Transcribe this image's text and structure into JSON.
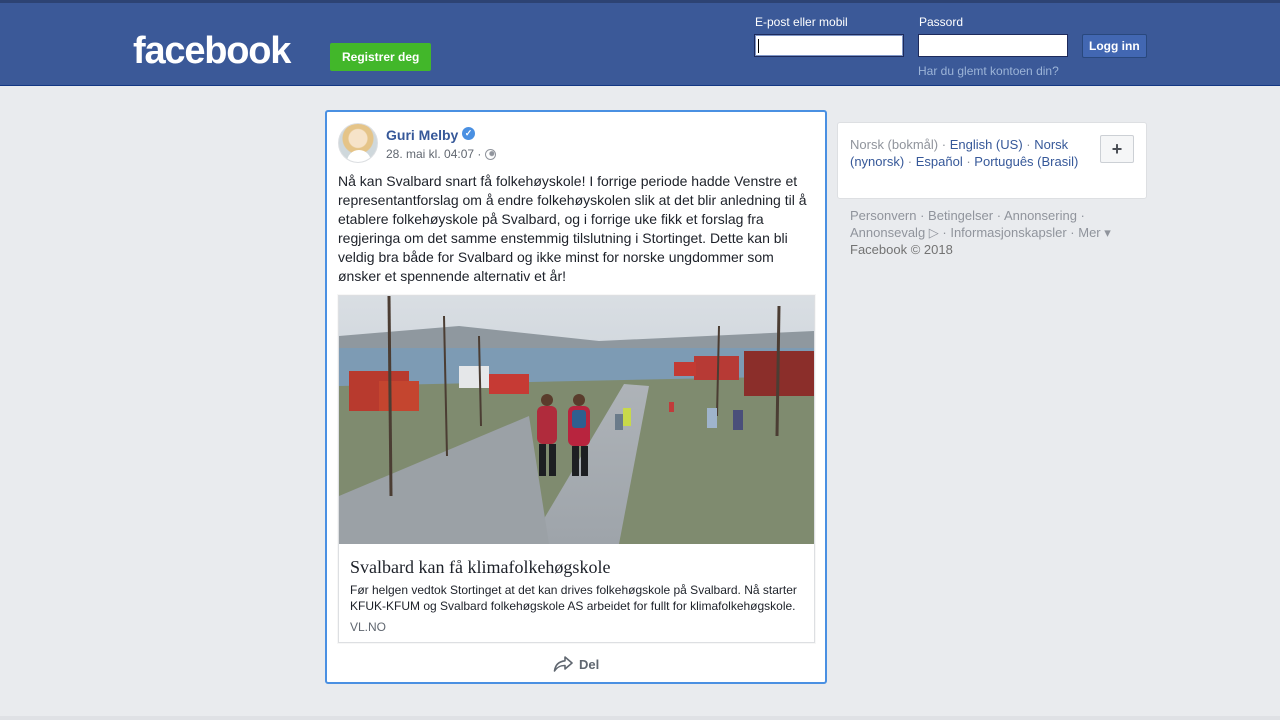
{
  "header": {
    "logo": "facebook",
    "register_label": "Registrer deg",
    "email_label": "E-post eller mobil",
    "password_label": "Passord",
    "login_label": "Logg inn",
    "forgot_label": "Har du glemt kontoen din?",
    "email_value": "",
    "password_value": ""
  },
  "post": {
    "author": "Guri Melby",
    "timestamp": "28. mai kl. 04:07 ·",
    "text": "Nå kan Svalbard snart få folkehøyskole! I forrige periode hadde Venstre et representantforslag om å endre folkehøyskolen slik at det blir anledning til å etablere folkehøyskole på Svalbard, og i forrige uke fikk et forslag fra regjeringa om det samme enstemmig tilslutning i Stortinget. Dette kan bli veldig bra både for Svalbard og ikke minst for norske ungdommer som ønsker et spennende alternativ et år!",
    "link": {
      "title": "Svalbard kan få klimafolkehøgskole",
      "description": "Før helgen vedtok Stortinget at det kan drives folkehøgskole på Svalbard. Nå starter KFUK-KFUM og Svalbard folkehøgskole AS arbeidet for fullt for klimafolkehøgskole.",
      "domain": "VL.NO"
    },
    "share_label": "Del",
    "icons": {
      "verified": "verified-badge-icon",
      "privacy": "globe-icon",
      "share": "share-arrow-icon"
    }
  },
  "languages": {
    "current": "Norsk (bokmål)",
    "items": [
      "English (US)",
      "Norsk (nynorsk)",
      "Español",
      "Português (Brasil)"
    ],
    "add_label": "+"
  },
  "footer": {
    "links": [
      "Personvern",
      "Betingelser",
      "Annonsering",
      "Annonsevalg",
      "Informasjonskapsler",
      "Mer"
    ],
    "copyright": "Facebook © 2018"
  },
  "colors": {
    "brand": "#3b5998",
    "register_green": "#42b72a",
    "link_blue": "#365899",
    "focus_border": "#4a90e2"
  }
}
